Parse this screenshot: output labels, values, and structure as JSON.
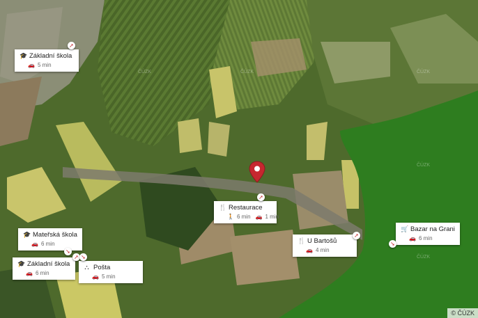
{
  "map": {
    "type": "satellite",
    "pois": [
      {
        "id": "zakladni-skola-top",
        "icon": "school-icon",
        "title": "Základní škola",
        "times": [
          {
            "mode": "car-icon",
            "text": "5 min"
          }
        ]
      },
      {
        "id": "restaurace",
        "icon": "restaurant-icon",
        "title": "Restaurace",
        "times": [
          {
            "mode": "walk-icon",
            "text": "6 min"
          },
          {
            "mode": "car-icon",
            "text": "1 min"
          }
        ]
      },
      {
        "id": "u-bartosu",
        "icon": "restaurant-icon",
        "title": "U Bartošů",
        "times": [
          {
            "mode": "car-icon",
            "text": "4 min"
          }
        ]
      },
      {
        "id": "bazar",
        "icon": "cart-icon",
        "title": "Bazar na Granicy",
        "times": [
          {
            "mode": "car-icon",
            "text": "6 min"
          }
        ]
      },
      {
        "id": "materska-skola",
        "icon": "school-icon",
        "title": "Mateřská škola",
        "times": [
          {
            "mode": "car-icon",
            "text": "6 min"
          }
        ]
      },
      {
        "id": "zakladni-skola-bottom",
        "icon": "school-icon",
        "title": "Základní škola M...",
        "times": [
          {
            "mode": "car-icon",
            "text": "6 min"
          }
        ]
      },
      {
        "id": "posta",
        "icon": "post-office-icon",
        "title": "Pošta",
        "times": [
          {
            "mode": "car-icon",
            "text": "5 min"
          }
        ]
      }
    ],
    "watermark": "ČÚZK",
    "copyright": "© ČÚZK"
  }
}
